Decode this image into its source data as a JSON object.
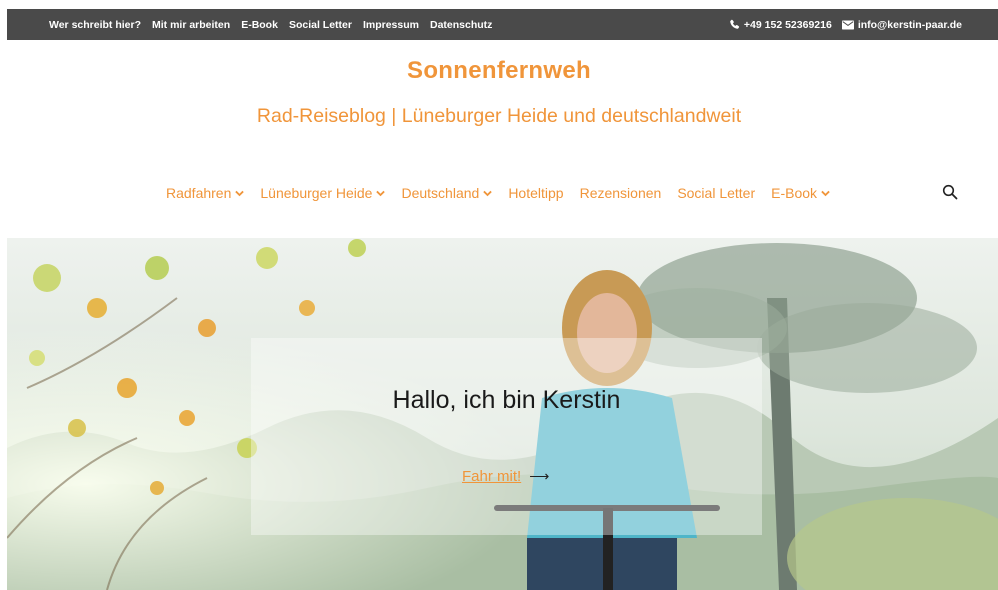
{
  "topbar": {
    "links": [
      "Wer schreibt hier?",
      "Mit mir arbeiten",
      "E-Book",
      "Social Letter",
      "Impressum",
      "Datenschutz"
    ],
    "phone": "+49 152 52369216",
    "email": "info@kerstin-paar.de"
  },
  "header": {
    "title": "Sonnenfernweh",
    "tagline": "Rad-Reiseblog | Lüneburger Heide und deutschlandweit"
  },
  "nav": {
    "items": [
      {
        "label": "Radfahren"
      },
      {
        "label": "Lüneburger Heide"
      },
      {
        "label": "Deutschland"
      },
      {
        "label": "Hoteltipp"
      },
      {
        "label": "Rezensionen"
      },
      {
        "label": "Social Letter"
      },
      {
        "label": "E-Book"
      }
    ]
  },
  "hero": {
    "title": "Hallo, ich bin Kerstin",
    "link": "Fahr mit!",
    "arrow": "⟶"
  },
  "colors": {
    "accent": "#f0953a",
    "topbar": "#4a4a4a"
  }
}
